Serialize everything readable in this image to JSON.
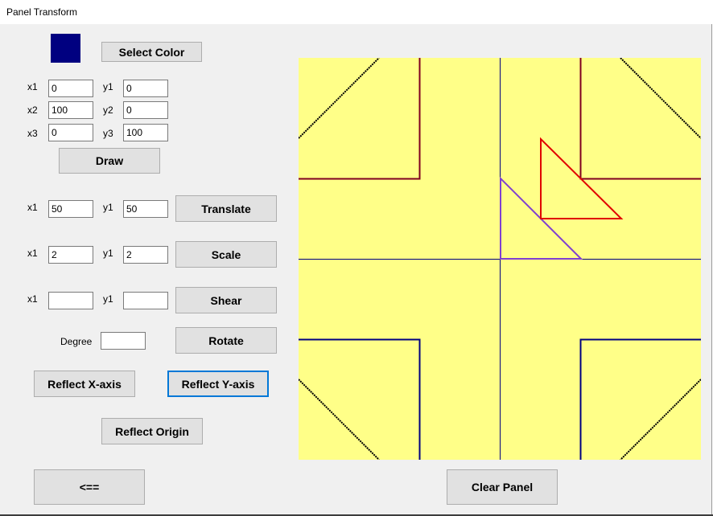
{
  "window": {
    "title": "Panel Transform"
  },
  "colors": {
    "swatch": "#000080",
    "panel_bg": "#ffff88",
    "axis": "#000080",
    "shape_red": "#e00000",
    "shape_purple": "#8040d0"
  },
  "select_color_label": "Select Color",
  "draw": {
    "x1_label": "x1",
    "x1_value": "0",
    "y1_label": "y1",
    "y1_value": "0",
    "x2_label": "x2",
    "x2_value": "100",
    "y2_label": "y2",
    "y2_value": "0",
    "x3_label": "x3",
    "x3_value": "0",
    "y3_label": "y3",
    "y3_value": "100",
    "button": "Draw"
  },
  "translate": {
    "x_label": "x1",
    "x_value": "50",
    "y_label": "y1",
    "y_value": "50",
    "button": "Translate"
  },
  "scale": {
    "x_label": "x1",
    "x_value": "2",
    "y_label": "y1",
    "y_value": "2",
    "button": "Scale"
  },
  "shear": {
    "x_label": "x1",
    "x_value": "",
    "y_label": "y1",
    "y_value": "",
    "button": "Shear"
  },
  "rotate": {
    "degree_label": "Degree",
    "degree_value": "",
    "button": "Rotate"
  },
  "reflect": {
    "x_axis": "Reflect X-axis",
    "y_axis": "Reflect Y-axis",
    "origin": "Reflect Origin"
  },
  "back_button": "<==",
  "clear_button": "Clear Panel"
}
